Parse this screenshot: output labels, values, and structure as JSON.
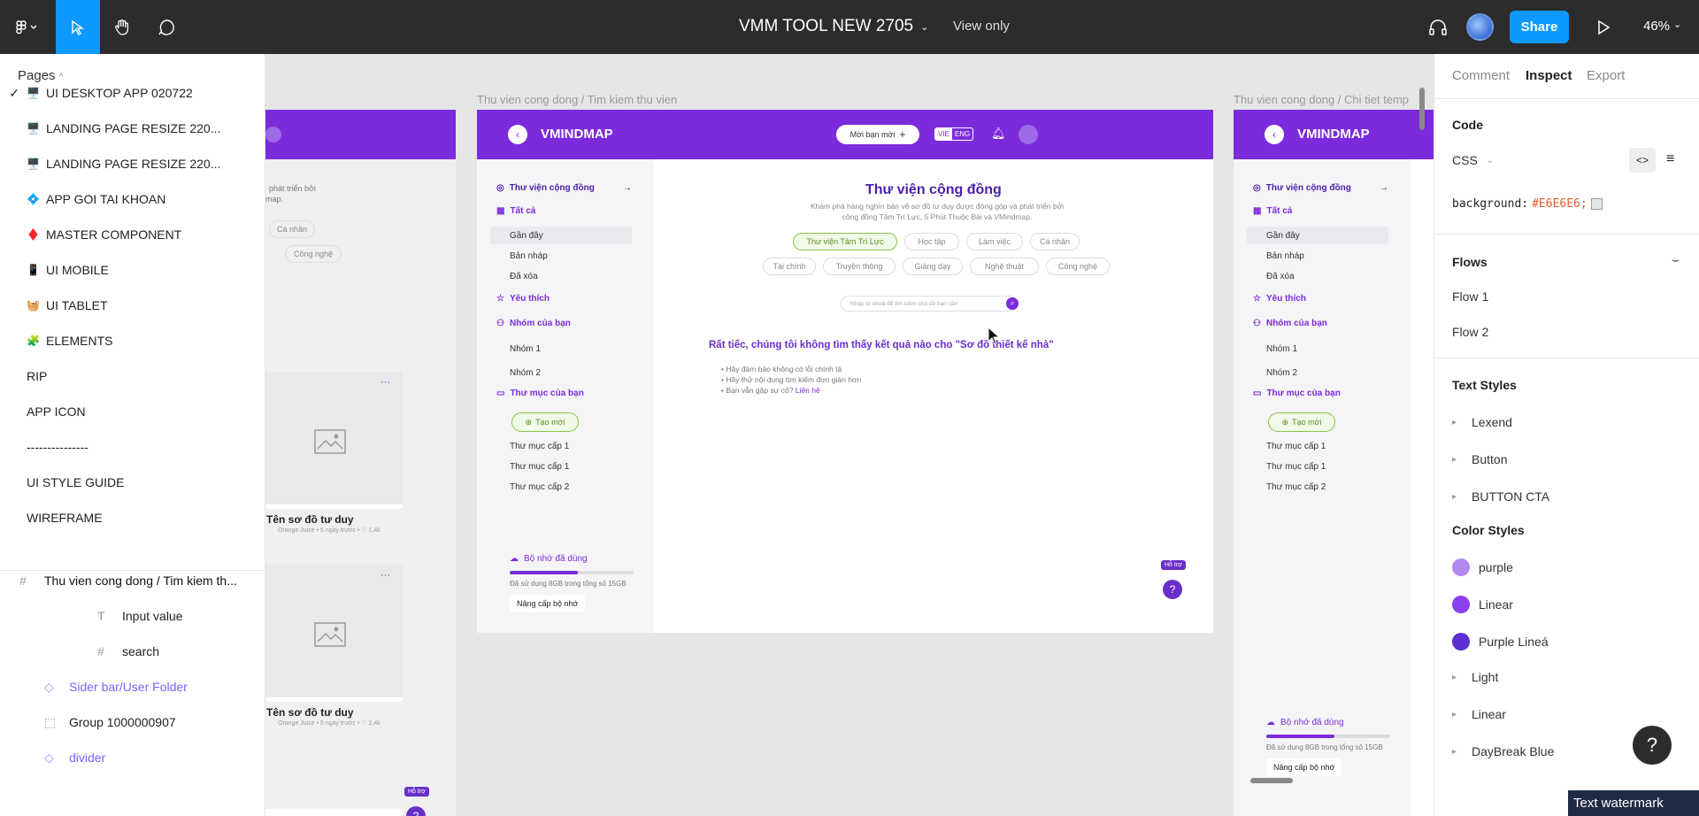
{
  "topbar": {
    "title": "VMM TOOL NEW 2705",
    "view_only": "View only",
    "share": "Share",
    "zoom": "46%"
  },
  "pages": {
    "header": "Pages",
    "items": [
      {
        "label": "UI DESKTOP APP 020722",
        "emoji": "🖥️",
        "checked": true
      },
      {
        "label": "LANDING PAGE RESIZE 220...",
        "emoji": "🖥️",
        "checked": false
      },
      {
        "label": "LANDING PAGE RESIZE 220...",
        "emoji": "🖥️",
        "checked": false
      },
      {
        "label": "APP GOI TAI KHOAN",
        "emoji": "💠",
        "checked": false
      },
      {
        "label": "MASTER COMPONENT",
        "emoji": "♦️",
        "checked": false
      },
      {
        "label": "UI MOBILE",
        "emoji": "📱",
        "checked": false
      },
      {
        "label": "UI TABLET",
        "emoji": "🧺",
        "checked": false
      },
      {
        "label": "ELEMENTS",
        "emoji": "🧩",
        "checked": false
      },
      {
        "label": "RIP",
        "emoji": "",
        "checked": false
      },
      {
        "label": "APP ICON",
        "emoji": "",
        "checked": false
      },
      {
        "label": "---------------",
        "emoji": "",
        "checked": false
      },
      {
        "label": "UI STYLE GUIDE",
        "emoji": "",
        "checked": false
      },
      {
        "label": "WIREFRAME",
        "emoji": "",
        "checked": false
      }
    ]
  },
  "layers": [
    {
      "label": "Thu vien cong dong / Tim kiem th...",
      "icon": "frame-icon"
    },
    {
      "label": "Input value",
      "icon": "text-icon"
    },
    {
      "label": "search",
      "icon": "frame-icon"
    },
    {
      "label": "Sider bar/User Folder",
      "icon": "component-icon"
    },
    {
      "label": "Group 1000000907",
      "icon": "group-icon"
    },
    {
      "label": "divider",
      "icon": "component-icon"
    }
  ],
  "canvas": {
    "frame_label_main": "Thu vien cong dong / Tim kiem thu vien",
    "frame_label_right": "Thu vien cong dong / Chi tiet temp",
    "logo": "VMINDMAP",
    "invite_btn": "Mời bạn mới",
    "lang_vie": "VIE",
    "lang_eng": "ENG",
    "sidebar": {
      "community": "Thư viện cộng đồng",
      "all": "Tất cả",
      "recent": "Gần đây",
      "draft": "Bản nháp",
      "deleted": "Đã xóa",
      "favorites": "Yêu thích",
      "groups": "Nhóm của bạn",
      "group1": "Nhóm 1",
      "group2": "Nhóm 2",
      "folders": "Thư mục của bạn",
      "new": "Tạo mới",
      "folder1a": "Thư mục cấp 1",
      "folder1b": "Thư mục cấp 1",
      "folder2": "Thư mục cấp 2",
      "storage": "Bộ nhớ đã dùng",
      "storage_used": "Đã sử dụng 8GB trong tổng số 15GB",
      "upgrade": "Nâng cấp bộ nhớ"
    },
    "main": {
      "title": "Thư viện cộng đồng",
      "desc1": "Khám phá hàng nghìn bản vẽ sơ đồ tư duy được đóng góp và phát triển bởi",
      "desc2": "cộng đồng Tâm Trí Lực, 5 Phút Thuộc Bài và VMindmap.",
      "chips_row1": [
        "Thư viện Tâm Trí Lực",
        "Học tập",
        "Làm việc",
        "Cá nhân"
      ],
      "chips_row2": [
        "Tài chính",
        "Truyền thông",
        "Giảng dạy",
        "Nghệ thuật",
        "Công nghệ"
      ],
      "search_placeholder": "Nhập từ khoá để tìm kiếm chủ đề bạn cần",
      "no_result": "Rất tiếc, chúng tôi không tìm thấy kết quả nào cho \"Sơ đồ thiết kế nhà\"",
      "tips": [
        "Hãy đảm bảo không có lỗi chính tả",
        "Hãy thử nội dung tìm kiếm đơn giản hơn",
        "Bạn vẫn gặp sự cố?"
      ],
      "contact": "Liên hệ",
      "help_tip": "Hỗ trợ"
    },
    "left_frame": {
      "desc": "phát triển bởi",
      "desc2": "map.",
      "chip_personal": "Cá nhân",
      "chip_tech": "Công nghệ",
      "card_title": "Tên sơ đồ tư duy",
      "card_meta": "Orange Juice • 5 ngày trước • ♡ 1,4k",
      "card_meta2": "Orange Juice • 5 ngày trước • ♡ 2,4k",
      "more": "···"
    }
  },
  "inspect": {
    "tabs": [
      "Comment",
      "Inspect",
      "Export"
    ],
    "code_header": "Code",
    "css_label": "CSS",
    "css_prop": "background:",
    "css_value": "#E6E6E6;",
    "flows_header": "Flows",
    "flows": [
      "Flow 1",
      "Flow 2"
    ],
    "text_styles_header": "Text Styles",
    "text_styles": [
      "Lexend",
      "Button",
      "BUTTON CTA"
    ],
    "color_styles_header": "Color Styles",
    "color_styles": [
      {
        "label": "purple",
        "color": "#b389f0",
        "swatch": true
      },
      {
        "label": "Linear",
        "color": "#8b3ff0",
        "swatch": true
      },
      {
        "label": "Purple Lineá",
        "color": "#5b2fd1",
        "swatch": true
      },
      {
        "label": "Light",
        "swatch": false
      },
      {
        "label": "Linear",
        "swatch": false
      },
      {
        "label": "DayBreak Blue",
        "swatch": false
      }
    ]
  },
  "help": "?",
  "watermark": "Text watermark"
}
